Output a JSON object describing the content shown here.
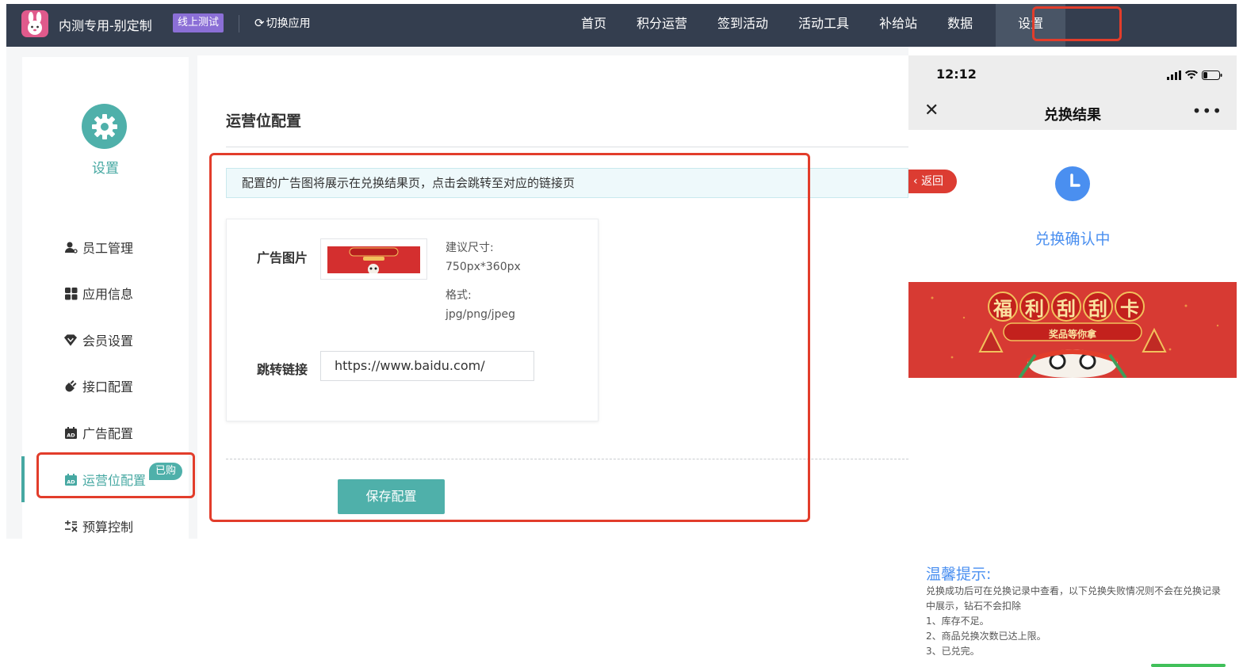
{
  "topbar": {
    "app_title": "内测专用-别定制",
    "env_badge": "线上测试",
    "switch_app": "切换应用",
    "nav": [
      {
        "label": "首页"
      },
      {
        "label": "积分运营"
      },
      {
        "label": "签到活动"
      },
      {
        "label": "活动工具"
      },
      {
        "label": "补给站"
      },
      {
        "label": "数据"
      },
      {
        "label": "设置",
        "active": true
      }
    ]
  },
  "sidebar": {
    "title": "设置",
    "items": [
      {
        "label": "员工管理",
        "icon": "user-icon"
      },
      {
        "label": "应用信息",
        "icon": "grid-icon"
      },
      {
        "label": "会员设置",
        "icon": "diamond-icon"
      },
      {
        "label": "接口配置",
        "icon": "plug-icon"
      },
      {
        "label": "广告配置",
        "icon": "ad-calendar-icon"
      },
      {
        "label": "运营位配置",
        "icon": "ad-calendar-icon",
        "active": true,
        "badge": "已购"
      },
      {
        "label": "预算控制",
        "icon": "budget-icon"
      }
    ]
  },
  "main": {
    "title": "运营位配置",
    "notice": "配置的广告图将展示在兑换结果页，点击会跳转至对应的链接页",
    "ad_image_label": "广告图片",
    "size_hint_label": "建议尺寸:",
    "size_hint_value": "750px*360px",
    "format_label": "格式:",
    "format_value": "jpg/png/jpeg",
    "link_label": "跳转链接",
    "link_value": "https://www.baidu.com/",
    "save_button": "保存配置"
  },
  "phone": {
    "time": "12:12",
    "title": "兑换结果",
    "back": "返回",
    "status": "兑换确认中",
    "banner_title_chars": [
      "福",
      "利",
      "刮",
      "刮",
      "卡"
    ],
    "banner_subtitle": "奖品等你拿",
    "tips_title": "温馨提示:",
    "tips_lines": [
      "兑换成功后可在兑换记录中查看，以下兑换失败情况则不会在兑换记录中展示，钻石不会扣除",
      "1、库存不足。",
      "2、商品兑换次数已达上限。",
      "3、已兑完。"
    ]
  },
  "colors": {
    "topbar": "#343e4f",
    "accent_teal": "#4fb0aa",
    "highlight_red": "#e23d2b",
    "phone_blue": "#4a8ff0",
    "banner_red": "#d73a33"
  }
}
